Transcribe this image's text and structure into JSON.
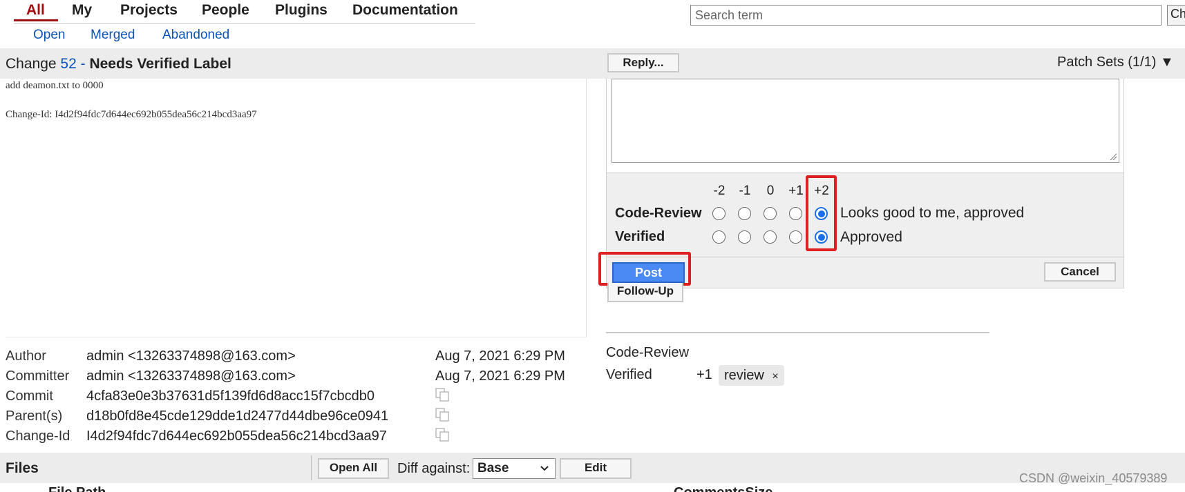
{
  "nav": {
    "tabs": [
      "All",
      "My",
      "Projects",
      "People",
      "Plugins",
      "Documentation"
    ],
    "subtabs": [
      "Open",
      "Merged",
      "Abandoned"
    ]
  },
  "search": {
    "placeholder": "Search term",
    "button_label": "Ch"
  },
  "change": {
    "prefix": "Change",
    "number": "52",
    "separator": "-",
    "status": "Needs Verified Label",
    "reply_button": "Reply...",
    "patch_sets": "Patch Sets (1/1) ▼"
  },
  "commit_message": {
    "line1": "add deamon.txt to 0000",
    "line2": "Change-Id: I4d2f94fdc7d644ec692b055dea56c214bcd3aa97"
  },
  "reply_popup": {
    "scores": [
      "-2",
      "-1",
      "0",
      "+1",
      "+2"
    ],
    "labels": [
      {
        "name": "Code-Review",
        "selected": "+2",
        "text": "Looks good to me, approved"
      },
      {
        "name": "Verified",
        "selected": "+2",
        "text": "Approved"
      }
    ],
    "post_label": "Post",
    "cancel_label": "Cancel",
    "highlight_color": "#e02020",
    "accent_color": "#4a8af4"
  },
  "follow_up_label": "Follow-Up",
  "commit_info": {
    "author_label": "Author",
    "author_value": "admin <13263374898@163.com>",
    "author_date": "Aug 7, 2021 6:29 PM",
    "committer_label": "Committer",
    "committer_value": "admin <13263374898@163.com>",
    "committer_date": "Aug 7, 2021 6:29 PM",
    "commit_label": "Commit",
    "commit_value": "4cfa83e0e3b37631d5f139fd6d8acc15f7cbcdb0",
    "parent_label": "Parent(s)",
    "parent_value": "d18b0fd8e45cde129dde1d2477d44dbe96ce0941",
    "changeid_label": "Change-Id",
    "changeid_value": "I4d2f94fdc7d644ec692b055dea56c214bcd3aa97"
  },
  "review_summary": {
    "code_review_label": "Code-Review",
    "verified_label": "Verified",
    "verified_score": "+1",
    "reviewer_chip": "review",
    "remove_glyph": "×"
  },
  "files": {
    "title": "Files",
    "open_all": "Open All",
    "diff_against": "Diff against:",
    "base_option": "Base",
    "edit_label": "Edit",
    "col_file_path": "File Path",
    "col_comments_size": "CommentsSize"
  },
  "watermark": "CSDN @weixin_40579389"
}
